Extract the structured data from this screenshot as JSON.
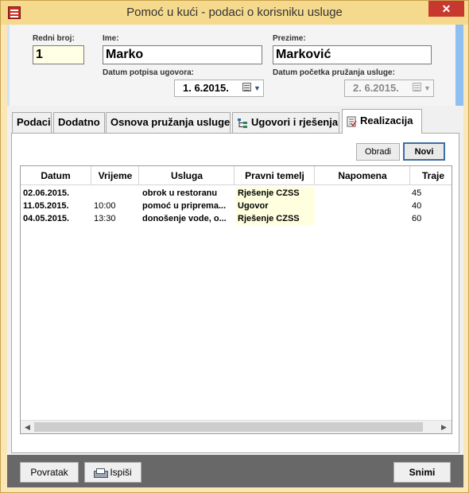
{
  "window": {
    "title": "Pomoć u kući - podaci o korisniku usluge",
    "close_glyph": "✕"
  },
  "header": {
    "redni_broj_label": "Redni broj:",
    "redni_broj": "1",
    "ime_label": "Ime:",
    "ime": "Marko",
    "prezime_label": "Prezime:",
    "prezime": "Marković",
    "datum_potpisa_label": "Datum potpisa ugovora:",
    "datum_potpisa": "1.  6.2015.",
    "datum_pocetka_label": "Datum početka pružanja usluge:",
    "datum_pocetka": "2.  6.2015."
  },
  "tabs": [
    {
      "label": "Podaci"
    },
    {
      "label": "Dodatno"
    },
    {
      "label": "Osnova pružanja usluge"
    },
    {
      "label": "Ugovori i rješenja",
      "icon": "tree-icon"
    },
    {
      "label": "Realizacija",
      "icon": "checklist-icon",
      "active": true
    }
  ],
  "panel": {
    "obradi_label": "Obradi",
    "novi_label": "Novi"
  },
  "grid": {
    "columns": [
      "Datum",
      "Vrijeme",
      "Usluga",
      "Pravni temelj",
      "Napomena",
      "Traje"
    ],
    "rows": [
      {
        "datum": "02.06.2015.",
        "vrijeme": "",
        "usluga": "obrok u restoranu",
        "pravni": "Rješenje CZSS",
        "napomena": "",
        "traje": "45"
      },
      {
        "datum": "11.05.2015.",
        "vrijeme": "10:00",
        "usluga": "pomoć u priprema...",
        "pravni": "Ugovor",
        "napomena": "",
        "traje": "40"
      },
      {
        "datum": "04.05.2015.",
        "vrijeme": "13:30",
        "usluga": "donošenje vode, o...",
        "pravni": "Rješenje CZSS",
        "napomena": "",
        "traje": "60"
      }
    ]
  },
  "footer": {
    "povratak_label": "Povratak",
    "ispisi_label": "Ispiši",
    "snimi_label": "Snimi"
  }
}
